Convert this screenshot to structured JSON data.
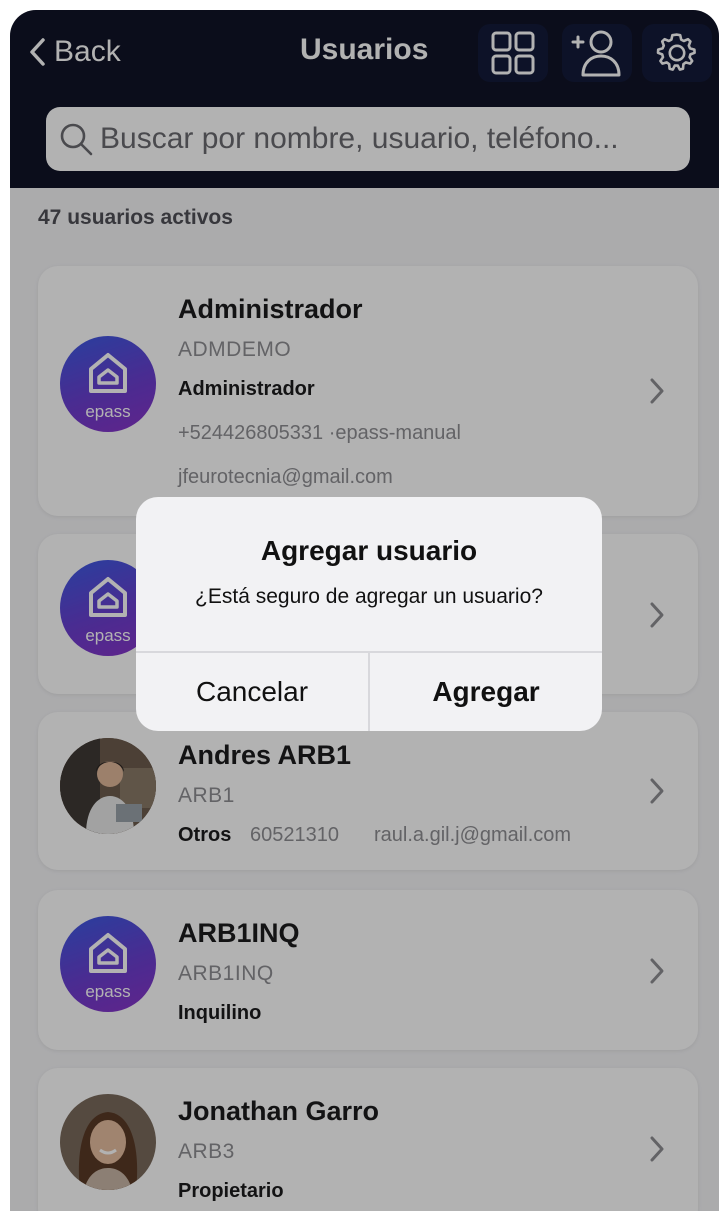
{
  "header": {
    "back_label": "Back",
    "title": "Usuarios",
    "icons": [
      "grid-icon",
      "add-user-icon",
      "settings-gear-icon"
    ]
  },
  "search": {
    "placeholder": "Buscar por nombre, usuario, teléfono..."
  },
  "summary": {
    "count_text": "47 usuarios activos"
  },
  "users": [
    {
      "name": "Administrador",
      "username": "ADMDEMO",
      "role": "Administrador",
      "phone": "+524426805331 ·epass-manual",
      "email": "jfeurotecnia@gmail.com",
      "avatar": "epass"
    },
    {
      "name": "",
      "username": "",
      "role": "",
      "avatar": "epass"
    },
    {
      "name": "Andres ARB1",
      "username": "ARB1",
      "role": "Otros",
      "phone": "60521310",
      "email": "raul.a.gil.j@gmail.com",
      "avatar": "photo"
    },
    {
      "name": "ARB1INQ",
      "username": "ARB1INQ",
      "role": "Inquilino",
      "avatar": "epass"
    },
    {
      "name": "Jonathan Garro",
      "username": "ARB3",
      "role": "Propietario",
      "avatar": "photo"
    }
  ],
  "avatar_logo_text": "epass",
  "dialog": {
    "title": "Agregar usuario",
    "message": "¿Está seguro de agregar un usuario?",
    "cancel_label": "Cancelar",
    "confirm_label": "Agregar"
  },
  "colors": {
    "header_bg": "#111428",
    "epass_gradient_start": "#3b5be3",
    "epass_gradient_end": "#8a34c8",
    "overlay": "rgba(0,0,0,0.3)"
  }
}
